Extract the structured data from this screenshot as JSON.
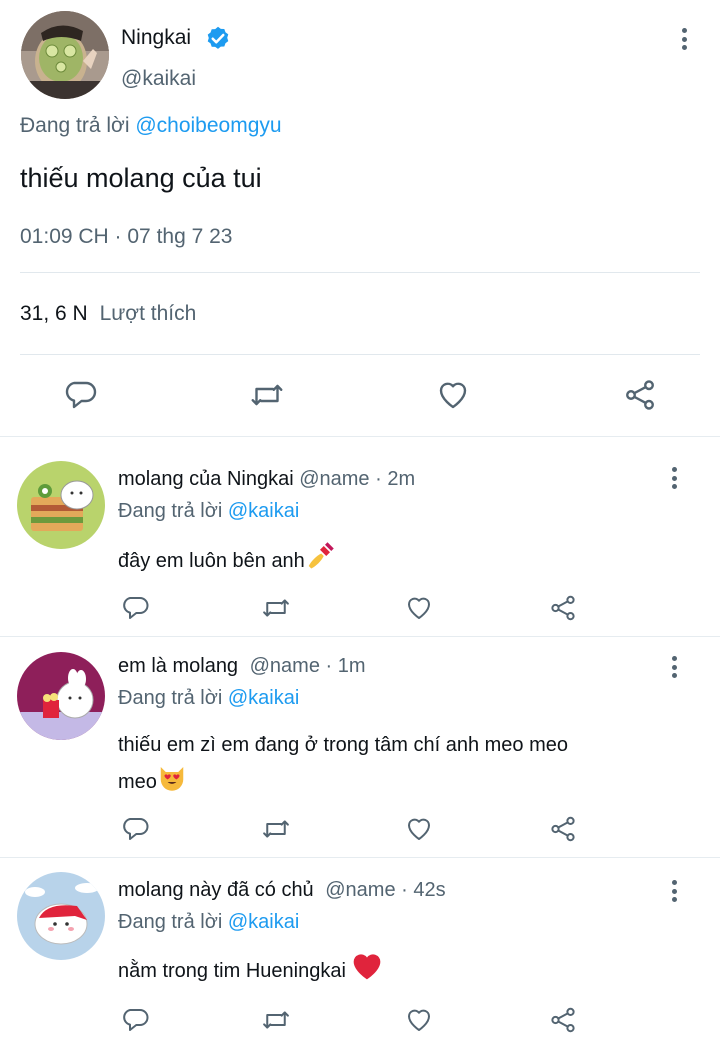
{
  "tweet": {
    "author_name": "Ningkai",
    "author_handle": "@kaikai",
    "replying_prefix": "Đang trả lời",
    "replying_to": "@choibeomgyu",
    "text": "thiếu molang của tui",
    "timestamp": "01:09 CH · 07 thg 7 23",
    "likes_count": "31, 6 N",
    "likes_label": "Lượt thích"
  },
  "replies": [
    {
      "name": "molang của Ningkai",
      "handle": "@name",
      "time": "· 2m",
      "replying_prefix": "Đang trả lời",
      "replying_to": "@kaikai",
      "text": "đây em luôn bên anh",
      "emoji": "nail-polish-emoji"
    },
    {
      "name": "em là molang",
      "handle": "@name",
      "time": "· 1m",
      "replying_prefix": "Đang trả lời",
      "replying_to": "@kaikai",
      "text_line1": "thiếu em zì em đang ở trong tâm chí anh meo meo",
      "text_line2": "meo",
      "emoji": "heart-eyes-cat-emoji"
    },
    {
      "name": "molang này đã có chủ",
      "handle": "@name",
      "time": "· 42s",
      "replying_prefix": "Đang trả lời",
      "replying_to": "@kaikai",
      "text": "nằm trong tim Hueningkai",
      "emoji": "red-heart-emoji"
    }
  ],
  "colors": {
    "link_blue": "#1d9bf0",
    "secondary_text": "#536471",
    "verified_blue": "#1d9bf0",
    "heart_red": "#e0243c"
  }
}
